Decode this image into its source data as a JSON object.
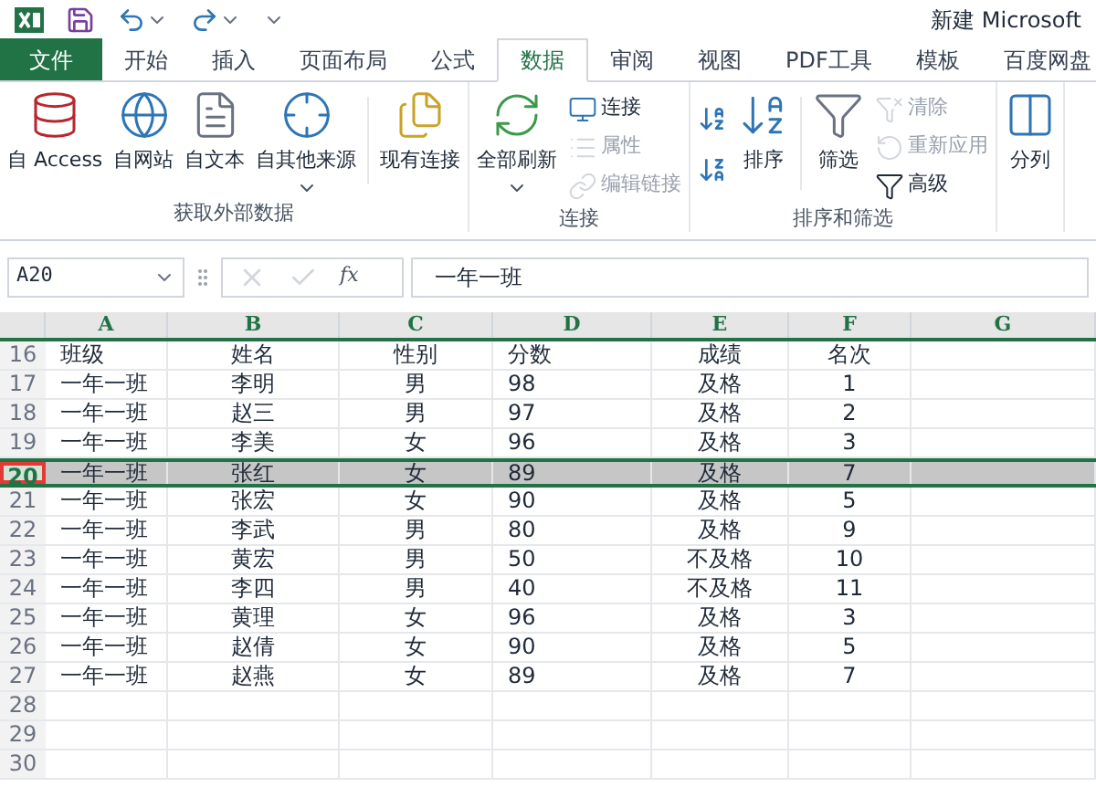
{
  "title_bar": {
    "title": "新建 Microsoft"
  },
  "tabs": [
    {
      "label": "文件",
      "kind": "file",
      "selected": false
    },
    {
      "label": "开始",
      "kind": "tab",
      "selected": false
    },
    {
      "label": "插入",
      "kind": "tab",
      "selected": false
    },
    {
      "label": "页面布局",
      "kind": "tab",
      "selected": false
    },
    {
      "label": "公式",
      "kind": "tab",
      "selected": false
    },
    {
      "label": "数据",
      "kind": "tab",
      "selected": true
    },
    {
      "label": "审阅",
      "kind": "tab",
      "selected": false
    },
    {
      "label": "视图",
      "kind": "tab",
      "selected": false
    },
    {
      "label": "PDF工具",
      "kind": "tab",
      "selected": false
    },
    {
      "label": "模板",
      "kind": "tab",
      "selected": false
    },
    {
      "label": "百度网盘",
      "kind": "tab",
      "selected": false
    }
  ],
  "ribbon_groups": [
    {
      "label": "获取外部数据",
      "items": [
        {
          "kind": "large",
          "label": "自 Access",
          "disabled": false
        },
        {
          "kind": "large",
          "label": "自网站",
          "disabled": false
        },
        {
          "kind": "large",
          "label": "自文本",
          "disabled": false
        },
        {
          "kind": "large",
          "label": "自其他来源",
          "disabled": false,
          "dropdown": true
        },
        {
          "kind": "divider"
        },
        {
          "kind": "large",
          "label": "现有连接",
          "disabled": false
        }
      ]
    },
    {
      "label": "连接",
      "items": [
        {
          "kind": "large",
          "label": "全部刷新",
          "disabled": false,
          "dropdown": true
        },
        {
          "kind": "small",
          "label": "连接",
          "disabled": false
        },
        {
          "kind": "small",
          "label": "属性",
          "disabled": true
        },
        {
          "kind": "small",
          "label": "编辑链接",
          "disabled": true
        }
      ]
    },
    {
      "label": "排序和筛选",
      "items": [
        {
          "kind": "sort_icons"
        },
        {
          "kind": "large",
          "label": "排序",
          "disabled": false
        },
        {
          "kind": "divider"
        },
        {
          "kind": "large",
          "label": "筛选",
          "disabled": false
        },
        {
          "kind": "small",
          "label": "清除",
          "disabled": true
        },
        {
          "kind": "small",
          "label": "重新应用",
          "disabled": true
        },
        {
          "kind": "small",
          "label": "高级",
          "disabled": false
        }
      ]
    },
    {
      "items": [
        {
          "kind": "large",
          "label": "分列",
          "disabled": false
        }
      ]
    }
  ],
  "formula_bar": {
    "name_box": "A20",
    "fx": "fx",
    "value": "一年一班"
  },
  "sheet": {
    "columns": [
      "A",
      "B",
      "C",
      "D",
      "E",
      "F",
      "G"
    ],
    "rows": [
      {
        "number": "16",
        "selected": false,
        "cells": [
          "班级",
          "姓名",
          "性别",
          "分数",
          "成绩",
          "名次"
        ]
      },
      {
        "number": "17",
        "selected": false,
        "cells": [
          "一年一班",
          "李明",
          "男",
          "98",
          "及格",
          "1"
        ]
      },
      {
        "number": "18",
        "selected": false,
        "cells": [
          "一年一班",
          "赵三",
          "男",
          "97",
          "及格",
          "2"
        ]
      },
      {
        "number": "19",
        "selected": false,
        "cells": [
          "一年一班",
          "李美",
          "女",
          "96",
          "及格",
          "3"
        ]
      },
      {
        "number": "20",
        "selected": true,
        "cells": [
          "一年一班",
          "张红",
          "女",
          "89",
          "及格",
          "7"
        ]
      },
      {
        "number": "21",
        "selected": false,
        "cells": [
          "一年一班",
          "张宏",
          "女",
          "90",
          "及格",
          "5"
        ]
      },
      {
        "number": "22",
        "selected": false,
        "cells": [
          "一年一班",
          "李武",
          "男",
          "80",
          "及格",
          "9"
        ]
      },
      {
        "number": "23",
        "selected": false,
        "cells": [
          "一年一班",
          "黄宏",
          "男",
          "50",
          "不及格",
          "10"
        ]
      },
      {
        "number": "24",
        "selected": false,
        "cells": [
          "一年一班",
          "李四",
          "男",
          "40",
          "不及格",
          "11"
        ]
      },
      {
        "number": "25",
        "selected": false,
        "cells": [
          "一年一班",
          "黄理",
          "女",
          "96",
          "及格",
          "3"
        ]
      },
      {
        "number": "26",
        "selected": false,
        "cells": [
          "一年一班",
          "赵倩",
          "女",
          "90",
          "及格",
          "5"
        ]
      },
      {
        "number": "27",
        "selected": false,
        "cells": [
          "一年一班",
          "赵燕",
          "女",
          "89",
          "及格",
          "7"
        ]
      },
      {
        "number": "28",
        "selected": false
      },
      {
        "number": "29",
        "selected": false
      },
      {
        "number": "30",
        "selected": false
      }
    ]
  }
}
